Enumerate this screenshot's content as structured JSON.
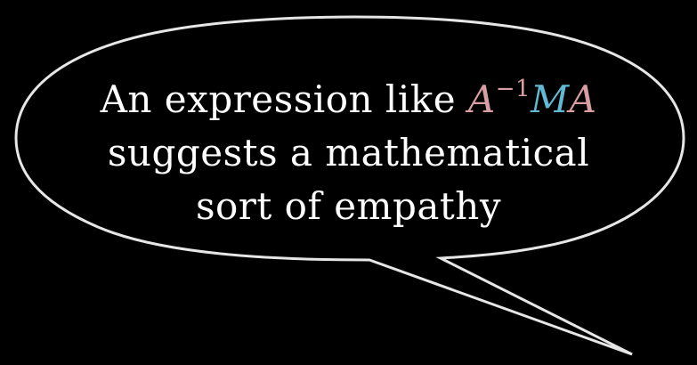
{
  "speech_bubble": {
    "line1_prefix": "An expression like ",
    "math": {
      "a_inverse": "A",
      "exponent": "−1",
      "m": "M",
      "a": "A"
    },
    "line2": "suggests a mathematical",
    "line3": "sort of empathy"
  },
  "colors": {
    "background": "#000000",
    "text": "#ffffff",
    "outline": "#e6e6e6",
    "a_color": "#d99ea1",
    "m_color": "#62b9d4"
  }
}
